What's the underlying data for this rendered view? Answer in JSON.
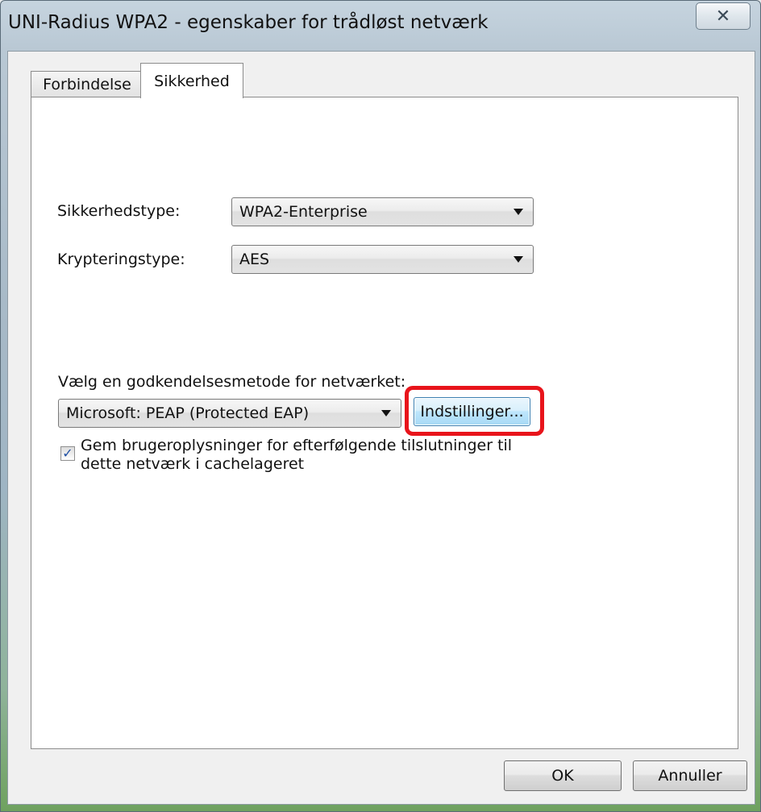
{
  "window": {
    "title": "UNI-Radius WPA2 - egenskaber for trådløst netværk",
    "close_glyph": "✕"
  },
  "tabs": [
    {
      "label": "Forbindelse",
      "selected": false
    },
    {
      "label": "Sikkerhed",
      "selected": true
    }
  ],
  "security": {
    "security_type_label": "Sikkerhedstype:",
    "security_type_value": "WPA2-Enterprise",
    "encryption_type_label": "Krypteringstype:",
    "encryption_type_value": "AES",
    "auth_method_label": "Vælg en godkendelsesmetode for netværket:",
    "auth_method_value": "Microsoft: PEAP (Protected EAP)",
    "settings_button": "Indstillinger...",
    "cache_checkbox_line1": "Gem brugeroplysninger for efterfølgende tilslutninger til",
    "cache_checkbox_line2": "dette netværk i cachelageret",
    "cache_checked": true,
    "check_glyph": "✓"
  },
  "footer": {
    "ok_label": "OK",
    "cancel_label": "Annuller"
  },
  "colors": {
    "highlight": "#e8141b"
  }
}
